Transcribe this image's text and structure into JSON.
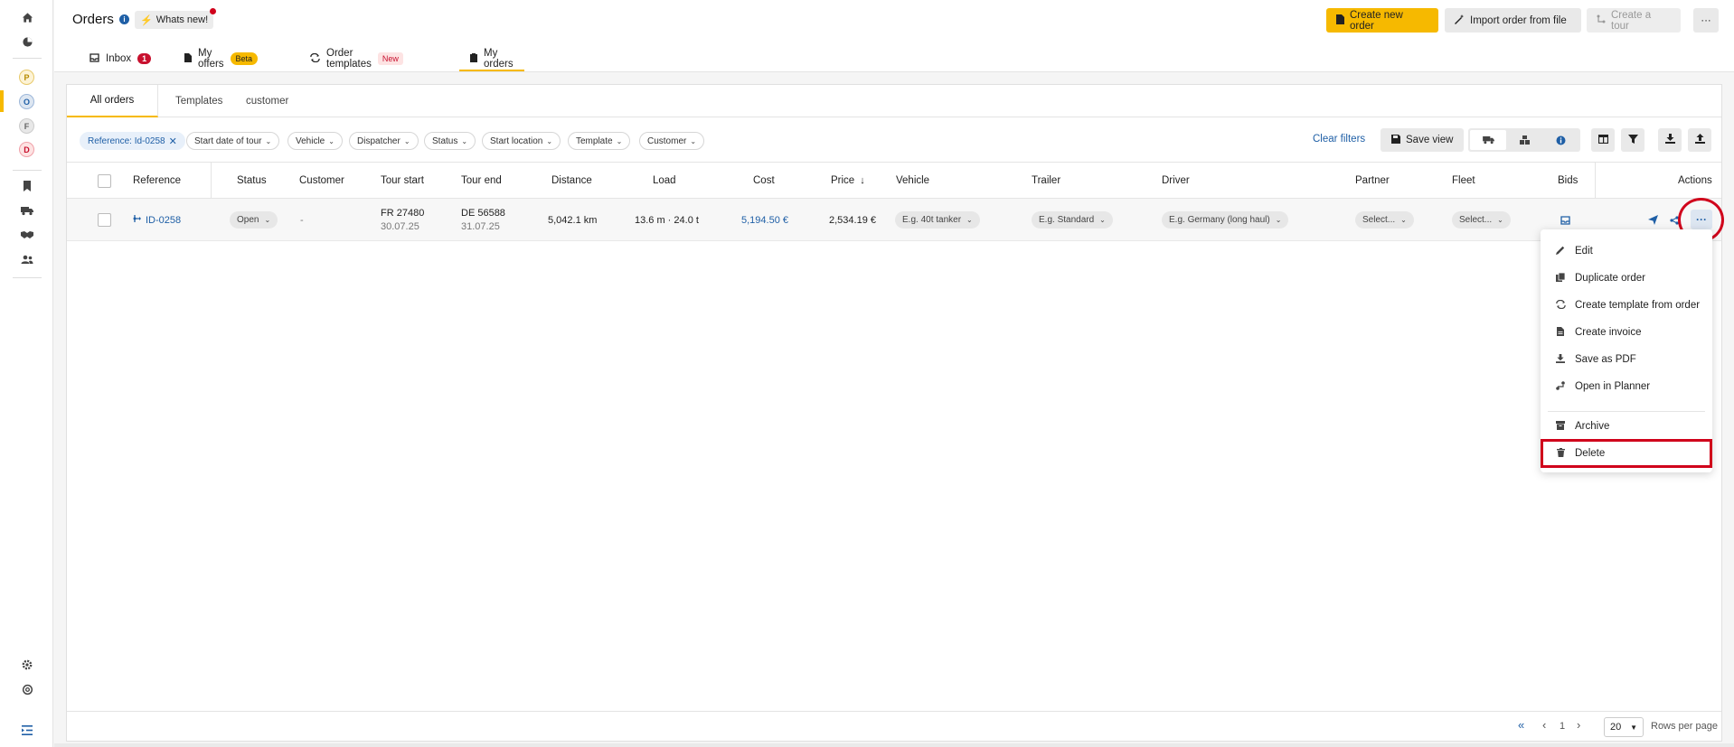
{
  "rail": {
    "icons": [
      "home-icon",
      "pie-chart-icon",
      "bookmark-icon",
      "truck-icon",
      "handshake-icon",
      "users-icon",
      "gear-icon",
      "support-icon",
      "collapse-icon"
    ],
    "letters": [
      {
        "label": "P",
        "bg": "#fdf3d6",
        "fg": "#b58a00"
      },
      {
        "label": "O",
        "bg": "#dde6f1",
        "fg": "#1f5fa6"
      },
      {
        "label": "F",
        "bg": "#e8e8e8",
        "fg": "#666666"
      },
      {
        "label": "D",
        "bg": "#fde3e3",
        "fg": "#c8102e"
      }
    ],
    "active_color": "#f6b900"
  },
  "header": {
    "title": "Orders",
    "whats_new": "Whats new!",
    "create_order": "Create new order",
    "import_order": "Import order from file",
    "create_tour": "Create a tour",
    "more": "···"
  },
  "tabs": [
    {
      "label": "Inbox",
      "badge": "1"
    },
    {
      "label": "My offers",
      "badge": "Beta"
    },
    {
      "label": "Order templates",
      "badge": "New"
    },
    {
      "label": "My orders",
      "badge": ""
    }
  ],
  "subtabs": [
    "All orders",
    "Templates",
    "customer"
  ],
  "filters": {
    "applied": "Reference: Id-0258",
    "chips": [
      "Start date of tour",
      "Vehicle",
      "Dispatcher",
      "Status",
      "Start location",
      "Template",
      "Customer"
    ],
    "clear": "Clear filters",
    "save_view": "Save view"
  },
  "columns": [
    "Reference",
    "Status",
    "Customer",
    "Tour start",
    "Tour end",
    "Distance",
    "Load",
    "Cost",
    "Price",
    "Vehicle",
    "Trailer",
    "Driver",
    "Partner",
    "Fleet",
    "Bids",
    "Actions"
  ],
  "rows": [
    {
      "reference": "ID-0258",
      "status": "Open",
      "customer": "-",
      "tour_start": "FR 27480",
      "tour_start_date": "30.07.25",
      "tour_end": "DE 56588",
      "tour_end_date": "31.07.25",
      "distance": "5,042.1 km",
      "load": "13.6 m · 24.0 t",
      "cost": "5,194.50 €",
      "price": "2,534.19 €",
      "vehicle": "E.g. 40t tanker",
      "trailer": "E.g. Standard",
      "driver": "E.g. Germany (long haul)",
      "partner": "Select...",
      "fleet": "Select..."
    }
  ],
  "menu": [
    "Edit",
    "Duplicate order",
    "Create template from order",
    "Create invoice",
    "Save as PDF",
    "Open in Planner",
    "Archive",
    "Delete"
  ],
  "pagination": {
    "page": "1",
    "rows_per_page": "20",
    "rows_label": "Rows per page"
  },
  "colors": {
    "accent": "#f6b900",
    "link": "#1f5fa6",
    "highlight": "#d0021b"
  }
}
